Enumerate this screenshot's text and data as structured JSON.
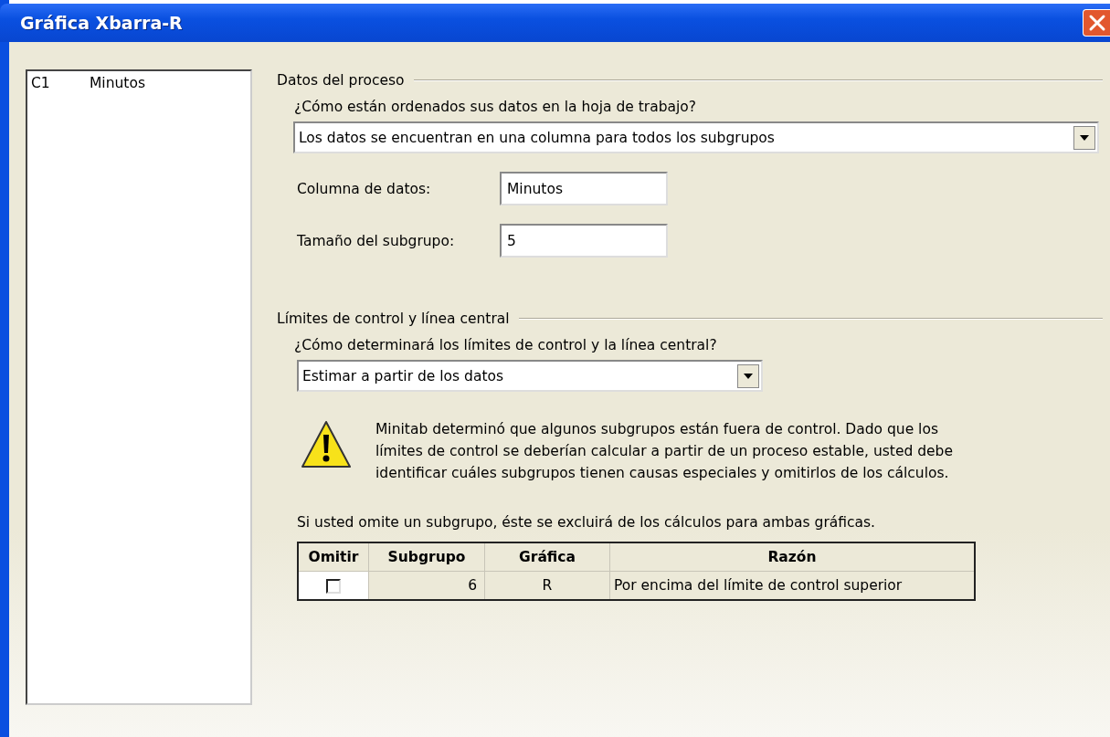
{
  "window": {
    "title": "Gráfica Xbarra-R"
  },
  "variables": [
    {
      "column": "C1",
      "name": "Minutos"
    }
  ],
  "process_data": {
    "heading": "Datos del proceso",
    "question": "¿Cómo están ordenados sus datos en la hoja de trabajo?",
    "arrangement": "Los datos se encuentran en una columna para todos los subgrupos",
    "fields": [
      {
        "label": "Columna de datos:",
        "value": "Minutos"
      },
      {
        "label": "Tamaño del subgrupo:",
        "value": "5"
      }
    ]
  },
  "control_limits": {
    "heading": "Límites de control y línea central",
    "question": "¿Cómo determinará los límites de control y la línea central?",
    "method": "Estimar a partir de los datos",
    "warning": "Minitab determinó que algunos subgrupos están fuera de control. Dado que los límites de control se deberían calcular a partir de un proceso estable, usted debe identificar cuáles subgrupos tienen causas especiales y omitirlos de los cálculos.",
    "note": "Si usted omite un subgrupo, éste se excluirá de los cálculos para ambas gráficas.",
    "table": {
      "columns": [
        "Omitir",
        "Subgrupo",
        "Gráfica",
        "Razón"
      ],
      "rows": [
        {
          "checked": false,
          "subgroup": "6",
          "chart": "R",
          "reason": "Por encima del límite de control superior"
        }
      ]
    }
  }
}
